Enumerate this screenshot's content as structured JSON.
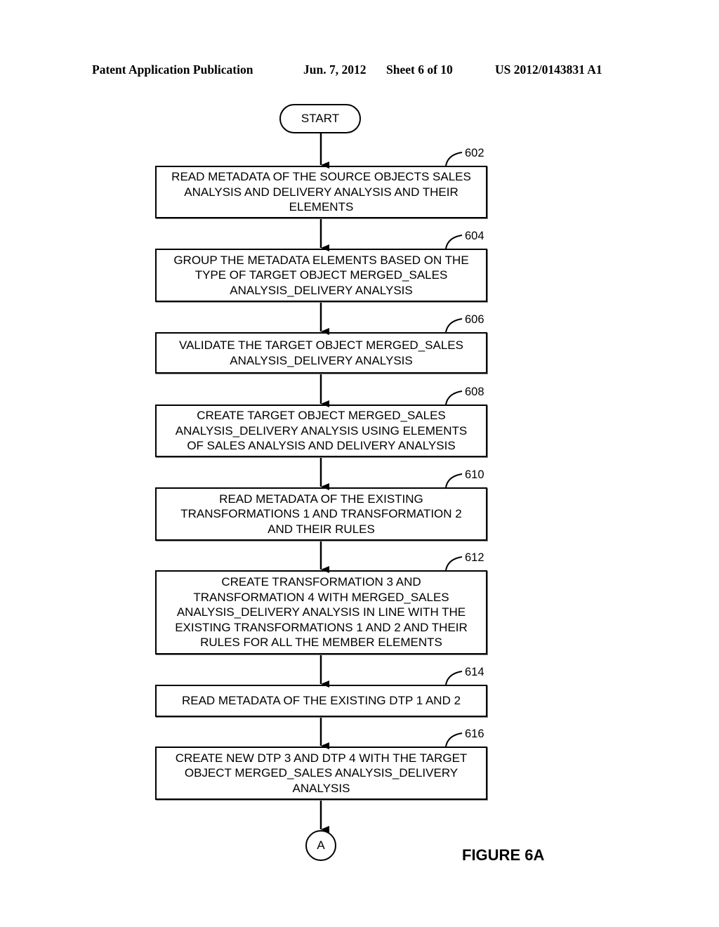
{
  "header": {
    "publication": "Patent Application Publication",
    "date": "Jun. 7, 2012",
    "sheet": "Sheet 6 of 10",
    "number": "US 2012/0143831 A1"
  },
  "start_label": "START",
  "steps": [
    {
      "ref": "602",
      "lines": [
        "READ METADATA OF THE SOURCE OBJECTS SALES",
        "ANALYSIS AND DELIVERY ANALYSIS AND THEIR",
        "ELEMENTS"
      ]
    },
    {
      "ref": "604",
      "lines": [
        "GROUP THE  METADATA ELEMENTS BASED ON THE",
        "TYPE OF TARGET OBJECT MERGED_SALES",
        "ANALYSIS_DELIVERY ANALYSIS"
      ]
    },
    {
      "ref": "606",
      "lines": [
        "VALIDATE THE TARGET OBJECT MERGED_SALES",
        "ANALYSIS_DELIVERY ANALYSIS"
      ]
    },
    {
      "ref": "608",
      "lines": [
        "CREATE TARGET OBJECT MERGED_SALES",
        "ANALYSIS_DELIVERY ANALYSIS USING ELEMENTS",
        "OF SALES ANALYSIS AND DELIVERY ANALYSIS"
      ]
    },
    {
      "ref": "610",
      "lines": [
        "READ METADATA OF THE EXISTING",
        "TRANSFORMATIONS 1 AND TRANSFORMATION 2",
        "AND THEIR RULES"
      ]
    },
    {
      "ref": "612",
      "lines": [
        "CREATE TRANSFORMATION 3 AND",
        "TRANSFORMATION 4 WITH MERGED_SALES",
        "ANALYSIS_DELIVERY ANALYSIS IN LINE WITH THE",
        "EXISTING TRANSFORMATIONS 1 AND 2 AND THEIR",
        "RULES FOR ALL THE MEMBER ELEMENTS"
      ]
    },
    {
      "ref": "614",
      "lines": [
        "READ METADATA OF THE EXISTING DTP 1 AND 2"
      ]
    },
    {
      "ref": "616",
      "lines": [
        "CREATE NEW DTP 3 AND DTP 4  WITH THE TARGET",
        "OBJECT MERGED_SALES ANALYSIS_DELIVERY",
        "ANALYSIS"
      ]
    }
  ],
  "connector_label": "A",
  "figure_label": "FIGURE 6A"
}
